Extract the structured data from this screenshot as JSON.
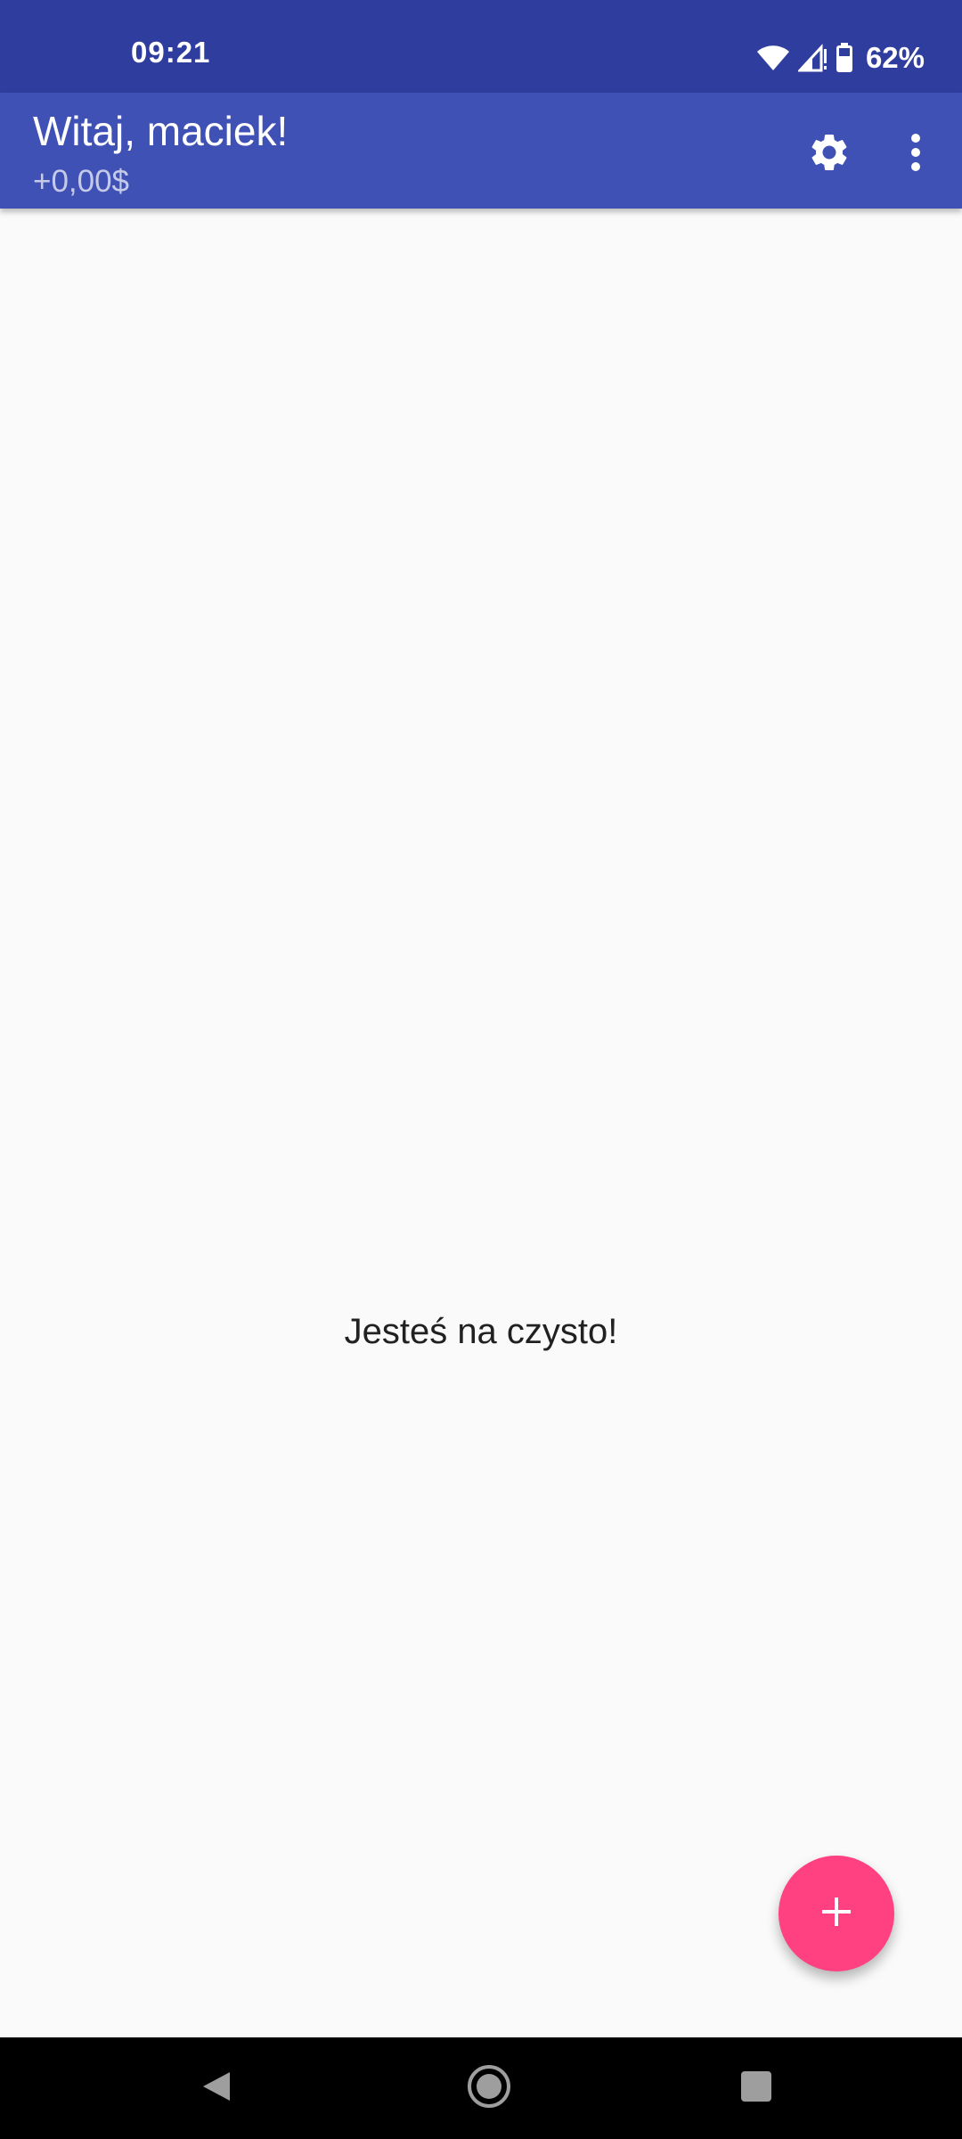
{
  "status_bar": {
    "time": "09:21",
    "battery": "62%",
    "icons": [
      "wifi-icon",
      "signal-icon",
      "battery-icon"
    ]
  },
  "app_bar": {
    "title": "Witaj, maciek!",
    "subtitle": "+0,00$",
    "actions": [
      "settings-icon",
      "more-vert-icon"
    ]
  },
  "main": {
    "empty_message": "Jesteś na czysto!"
  },
  "fab": {
    "icon": "add-icon"
  },
  "nav_bar": {
    "buttons": [
      "back-icon",
      "home-icon",
      "recents-icon"
    ]
  },
  "colors": {
    "status_bar": "#2f3e9e",
    "app_bar": "#3f51b5",
    "fab": "#ff4081",
    "background": "#fafafa"
  }
}
